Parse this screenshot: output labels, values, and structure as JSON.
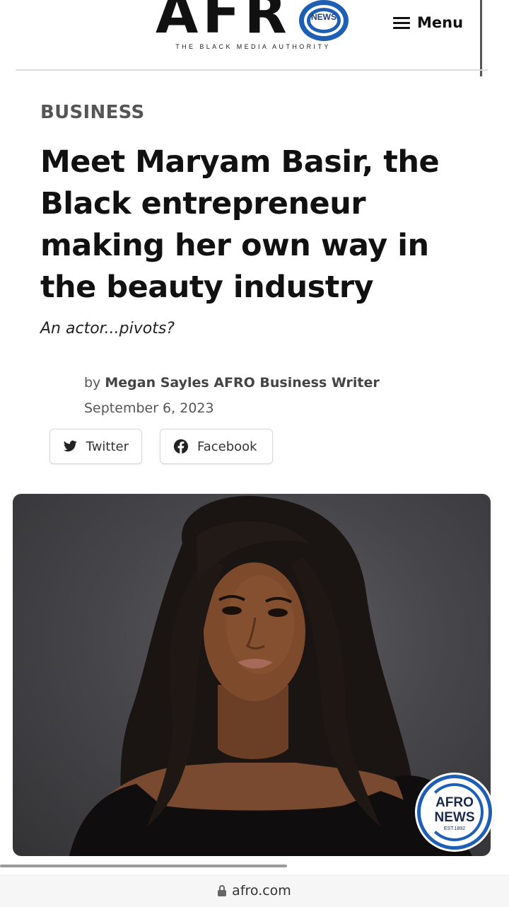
{
  "header": {
    "logo_text": "AFR",
    "logo_badge_text": "NEWS",
    "tagline": "THE BLACK MEDIA AUTHORITY",
    "menu_label": "Menu"
  },
  "article": {
    "category": "BUSINESS",
    "headline": "Meet Maryam Basir, the Black entrepreneur making her own way in the beauty industry",
    "dek": "An actor...pivots?",
    "byline_prefix": "by",
    "author": "Megan Sayles AFRO Business Writer",
    "date": "September 6, 2023"
  },
  "share": {
    "twitter_label": "Twitter",
    "facebook_label": "Facebook"
  },
  "badge": {
    "line1": "AFRO",
    "line2": "NEWS",
    "line3": "EST.1892"
  },
  "browser": {
    "url": "afro.com"
  },
  "colors": {
    "brand_blue": "#1f5fb3",
    "text_dark": "#111111",
    "category_gray": "#555555"
  }
}
